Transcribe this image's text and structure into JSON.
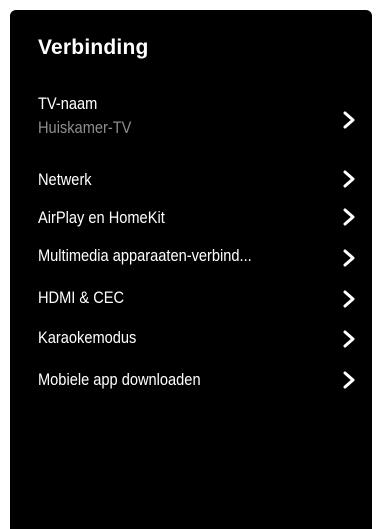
{
  "header": {
    "title": "Verbinding"
  },
  "menu": {
    "items": [
      {
        "label": "TV-naam",
        "value": "Huiskamer-TV",
        "icon": "chevron-right-icon"
      },
      {
        "label": "Netwerk",
        "icon": "chevron-right-icon"
      },
      {
        "label": "AirPlay en HomeKit",
        "icon": "chevron-right-icon"
      },
      {
        "label": "Multimedia apparaaten-verbind...",
        "icon": "chevron-right-icon"
      },
      {
        "label": "HDMI & CEC",
        "icon": "chevron-right-icon"
      },
      {
        "label": "Karaokemodus",
        "icon": "chevron-right-icon"
      },
      {
        "label": "Mobiele app downloaden",
        "icon": "chevron-right-icon"
      }
    ]
  },
  "colors": {
    "background": "#000000",
    "text": "#ffffff",
    "secondary_text": "#8e8e8e",
    "page": "#ffffff"
  }
}
